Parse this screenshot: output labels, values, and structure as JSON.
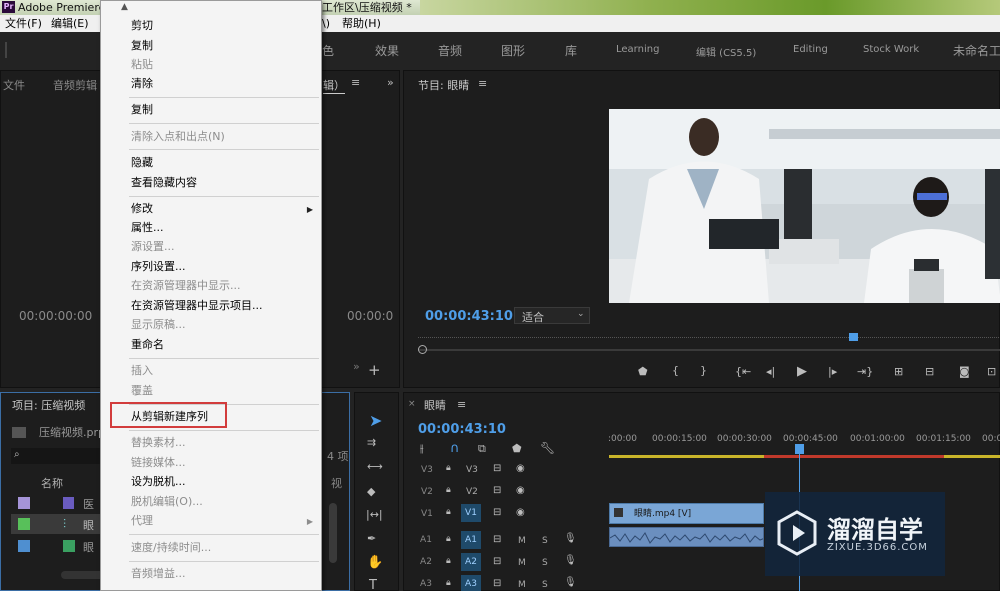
{
  "titlebar": {
    "app": "Pr",
    "title_left": "Adobe Premiere",
    "title_right": "工作区\\压缩视频 *"
  },
  "menubar": {
    "file": "文件(F)",
    "edit": "编辑(E)",
    "partial": "\\)",
    "help": "帮助(H)"
  },
  "workspace_tabs": [
    "色",
    "效果",
    "音频",
    "图形",
    "库",
    "Learning",
    "编辑 (CS5.5)",
    "Editing",
    "Stock Work",
    "未命名工"
  ],
  "source_panel": {
    "tabs": [
      "文件",
      "音频剪辑"
    ],
    "partial_tab": "辑）",
    "timecode_left": "00:00:00:00",
    "timecode_right": "00:00:0"
  },
  "program_panel": {
    "title": "节目: 眼睛",
    "timecode": "00:00:43:10",
    "fit_label": "适合"
  },
  "project_panel": {
    "title": "项目: 压缩视频",
    "file": "压缩视频.prp",
    "col_name": "名称",
    "col_right": "视",
    "items": [
      "医",
      "眼",
      "眼"
    ],
    "count_text": "4 项"
  },
  "timeline": {
    "title": "眼睛",
    "timecode": "00:00:43:10",
    "ruler": [
      ":00:00",
      "00:00:15:00",
      "00:00:30:00",
      "00:00:45:00",
      "00:01:00:00",
      "00:01:15:00",
      "00:01:"
    ],
    "tracks": [
      {
        "src": "V3",
        "name": "V3",
        "type": "video"
      },
      {
        "src": "V2",
        "name": "V2",
        "type": "video"
      },
      {
        "src": "V1",
        "name": "V1",
        "type": "video"
      },
      {
        "src": "A1",
        "name": "A1",
        "type": "audio"
      },
      {
        "src": "A2",
        "name": "A2",
        "type": "audio"
      },
      {
        "src": "A3",
        "name": "A3",
        "type": "audio"
      }
    ],
    "clip_label": "眼睛.mp4 [V]",
    "m_label": "M",
    "s_label": "S"
  },
  "context_menu": {
    "items": [
      {
        "label": "剪切",
        "disabled": false
      },
      {
        "label": "复制",
        "disabled": false
      },
      {
        "label": "粘贴",
        "disabled": true
      },
      {
        "label": "清除",
        "disabled": false
      },
      {
        "label": "复制",
        "disabled": false
      },
      {
        "label": "清除入点和出点(N)",
        "disabled": true
      },
      {
        "label": "隐藏",
        "disabled": false
      },
      {
        "label": "查看隐藏内容",
        "disabled": false
      },
      {
        "label": "修改",
        "disabled": false,
        "submenu": true
      },
      {
        "label": "属性...",
        "disabled": false
      },
      {
        "label": "源设置...",
        "disabled": true
      },
      {
        "label": "序列设置...",
        "disabled": false
      },
      {
        "label": "在资源管理器中显示...",
        "disabled": true
      },
      {
        "label": "在资源管理器中显示项目...",
        "disabled": false
      },
      {
        "label": "显示原稿...",
        "disabled": true
      },
      {
        "label": "重命名",
        "disabled": false
      },
      {
        "label": "插入",
        "disabled": true
      },
      {
        "label": "覆盖",
        "disabled": true
      },
      {
        "label": "从剪辑新建序列",
        "disabled": false,
        "highlighted": true
      },
      {
        "label": "替换素材...",
        "disabled": true
      },
      {
        "label": "链接媒体...",
        "disabled": true
      },
      {
        "label": "设为脱机...",
        "disabled": false
      },
      {
        "label": "脱机编辑(O)...",
        "disabled": true
      },
      {
        "label": "代理",
        "disabled": true,
        "submenu": true
      },
      {
        "label": "速度/持续时间...",
        "disabled": true
      },
      {
        "label": "音频增益...",
        "disabled": true
      }
    ]
  },
  "watermark": {
    "brand": "溜溜自学",
    "url": "ZIXUE.3D66.COM"
  },
  "colors": {
    "accent_blue": "#4f9ee8",
    "highlight_red": "#d23c3c",
    "clip_blue": "#7aa6d6",
    "audio_clip": "#6b8fbf"
  }
}
